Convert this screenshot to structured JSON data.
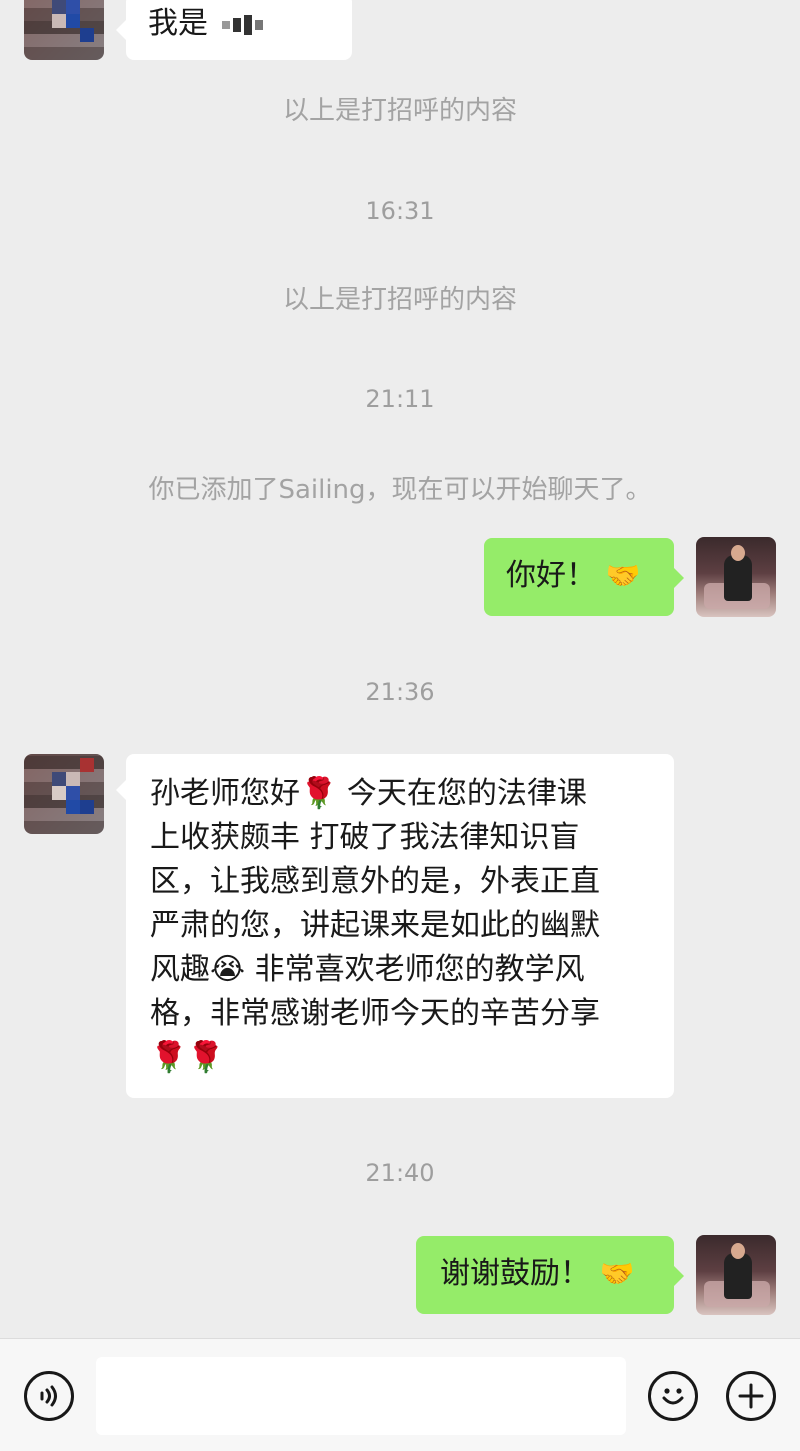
{
  "messages": {
    "m1_text": "我是",
    "sys1": "以上是打招呼的内容",
    "time1": "16:31",
    "sys2": "以上是打招呼的内容",
    "time2": "21:11",
    "sys3": "你已添加了Sailing，现在可以开始聊天了。",
    "m2_text": "你好！",
    "m2_emoji": "🤝",
    "time3": "21:36",
    "m3_lines": [
      "孙老师您好🌹 今天在您的法律课",
      "上收获颇丰 打破了我法律知识盲",
      "区，让我感到意外的是，外表正直",
      "严肃的您，讲起课来是如此的幽默",
      "风趣😭 非常喜欢老师您的教学风",
      "格，非常感谢老师今天的辛苦分享",
      "🌹🌹"
    ],
    "time4": "21:40",
    "m4_text": "谢谢鼓励！",
    "m4_emoji": "🤝"
  },
  "icons": {
    "voice": "voice-icon",
    "emoji": "emoji-icon",
    "plus": "plus-icon"
  },
  "colors": {
    "background": "#ededed",
    "sent_bubble": "#95ec69",
    "received_bubble": "#ffffff"
  }
}
